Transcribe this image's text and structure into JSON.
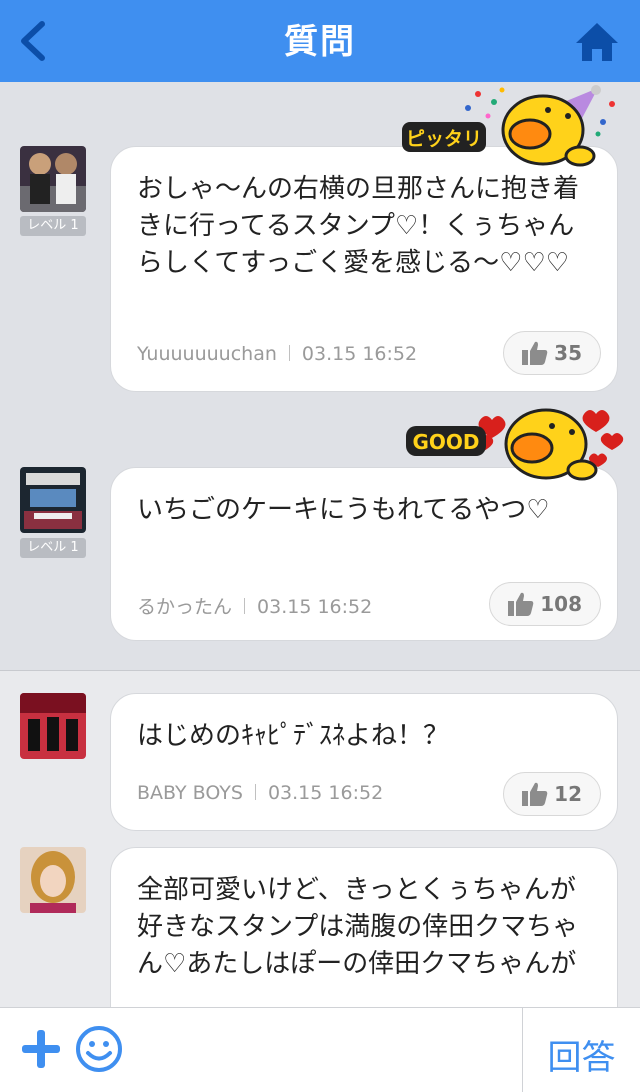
{
  "header": {
    "title": "質問"
  },
  "answers": [
    {
      "level": "レベル 1",
      "text": "おしゃ〜んの右横の旦那さんに抱き着きに行ってるスタンプ♡！くぅちゃんらしくてすっごく愛を感じる〜♡♡♡",
      "user": "Yuuuuuuuchan",
      "time": "03.15 16:52",
      "likes": "35",
      "sticker_text": "ピッタリ"
    },
    {
      "level": "レベル 1",
      "text": "いちごのケーキにうもれてるやつ♡",
      "user": "るかったん",
      "time": "03.15 16:52",
      "likes": "108",
      "sticker_text": "GOOD"
    },
    {
      "text": "はじめのｷｬﾋﾟﾃﾞｽﾈよね！？",
      "user": "BABY BOYS",
      "time": "03.15 16:52",
      "likes": "12"
    },
    {
      "text": "全部可愛いけど、きっとくぅちゃんが好きなスタンプは満腹の倖田クマちゃん♡あたしはぽーの倖田クマちゃんが"
    }
  ],
  "footer": {
    "answer_label": "回答"
  },
  "colors": {
    "accent": "#3f8ff0",
    "background": "#dfe1e6"
  }
}
